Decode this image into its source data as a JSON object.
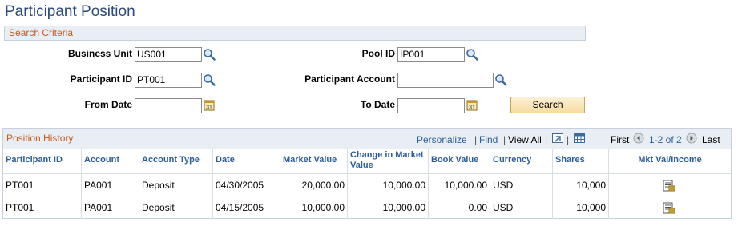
{
  "page_title": "Participant Position",
  "search_criteria": {
    "section_label": "Search Criteria",
    "business_unit": {
      "label": "Business Unit",
      "value": "US001"
    },
    "pool_id": {
      "label": "Pool ID",
      "value": "IP001"
    },
    "participant_id": {
      "label": "Participant ID",
      "value": "PT001"
    },
    "participant_account": {
      "label": "Participant Account",
      "value": ""
    },
    "from_date": {
      "label": "From Date",
      "value": ""
    },
    "to_date": {
      "label": "To Date",
      "value": ""
    },
    "search_button": "Search"
  },
  "grid": {
    "title": "Position History",
    "nav": {
      "personalize": "Personalize",
      "find": "Find",
      "view_all": "View All",
      "first": "First",
      "range": "1-2 of 2",
      "last": "Last",
      "sep": "|"
    },
    "columns": [
      "Participant ID",
      "Account",
      "Account Type",
      "Date",
      "Market Value",
      "Change in Market Value",
      "Book Value",
      "Currency",
      "Shares",
      "Mkt Val/Income"
    ],
    "rows": [
      [
        "PT001",
        "PA001",
        "Deposit",
        "04/30/2005",
        "20,000.00",
        "10,000.00",
        "10,000.00",
        "USD",
        "10,000"
      ],
      [
        "PT001",
        "PA001",
        "Deposit",
        "04/15/2005",
        "10,000.00",
        "10,000.00",
        "0.00",
        "USD",
        "10,000"
      ]
    ]
  },
  "icons": {
    "lookup": "magnifier-icon",
    "calendar": "calendar-icon",
    "zoom": "zoom-icon",
    "download": "download-spreadsheet-icon",
    "prev": "prev-arrow-icon",
    "next": "next-arrow-icon",
    "detail": "detail-report-icon"
  },
  "colors": {
    "title": "#2b4a7a",
    "section": "#cc5a1a",
    "link": "#2b5d9a",
    "button": "#f7dba0"
  }
}
